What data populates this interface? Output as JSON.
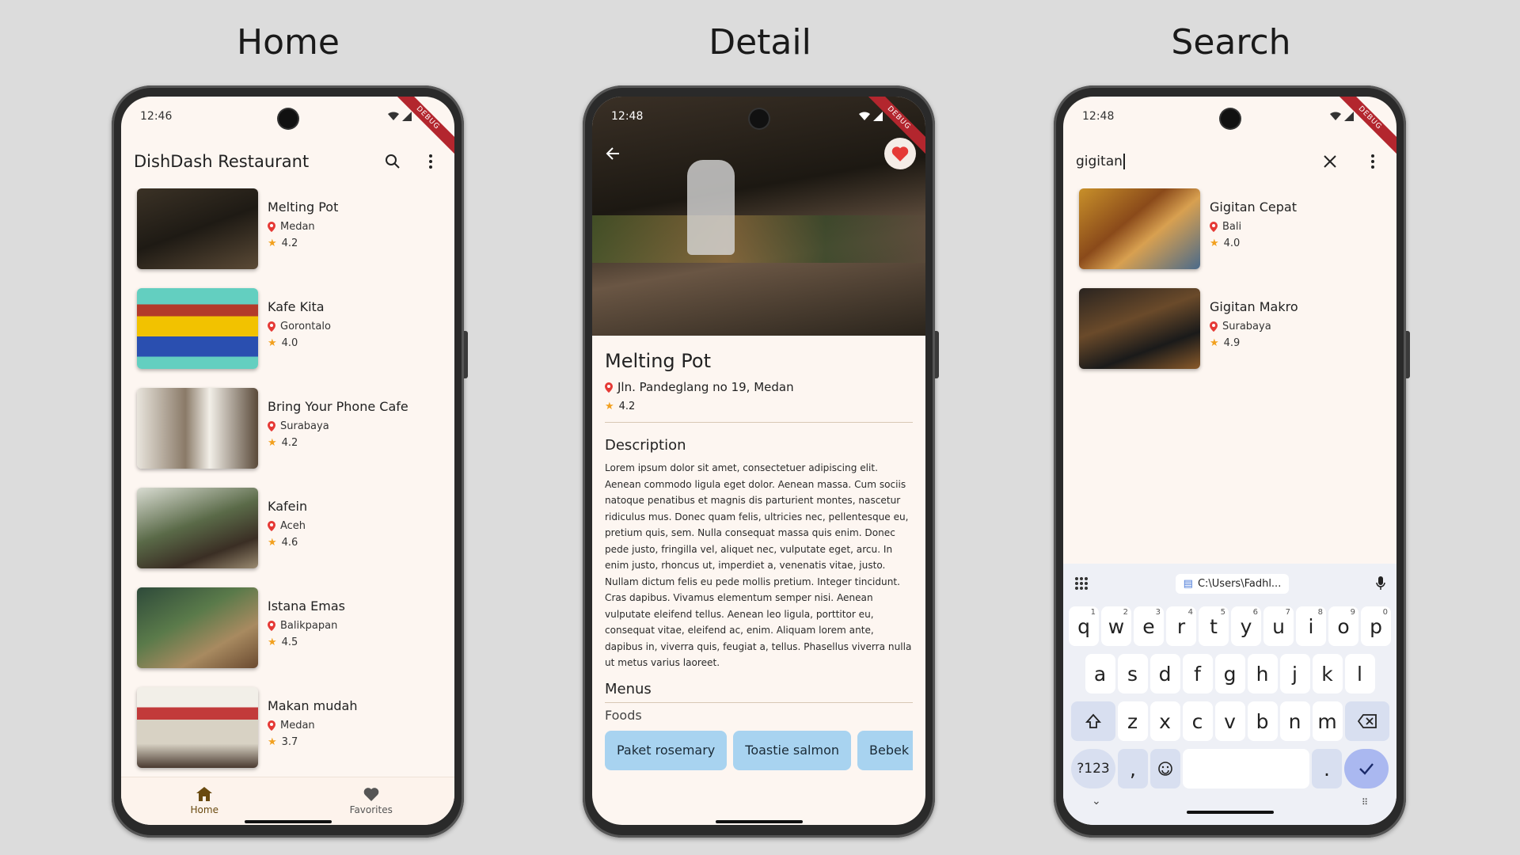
{
  "labels": {
    "home": "Home",
    "detail": "Detail",
    "search": "Search"
  },
  "debug_banner": "DEBUG",
  "home": {
    "time": "12:46",
    "title": "DishDash Restaurant",
    "restaurants": [
      {
        "name": "Melting Pot",
        "city": "Medan",
        "rating": "4.2"
      },
      {
        "name": "Kafe Kita",
        "city": "Gorontalo",
        "rating": "4.0"
      },
      {
        "name": "Bring Your Phone Cafe",
        "city": "Surabaya",
        "rating": "4.2"
      },
      {
        "name": "Kafein",
        "city": "Aceh",
        "rating": "4.6"
      },
      {
        "name": "Istana Emas",
        "city": "Balikpapan",
        "rating": "4.5"
      },
      {
        "name": "Makan mudah",
        "city": "Medan",
        "rating": "3.7"
      }
    ],
    "nav": {
      "home": "Home",
      "favorites": "Favorites"
    }
  },
  "detail": {
    "time": "12:48",
    "name": "Melting Pot",
    "address": "Jln. Pandeglang no 19, Medan",
    "rating": "4.2",
    "description_title": "Description",
    "description": "Lorem ipsum dolor sit amet, consectetuer adipiscing elit. Aenean commodo ligula eget dolor. Aenean massa. Cum sociis natoque penatibus et magnis dis parturient montes, nascetur ridiculus mus. Donec quam felis, ultricies nec, pellentesque eu, pretium quis, sem. Nulla consequat massa quis enim. Donec pede justo, fringilla vel, aliquet nec, vulputate eget, arcu. In enim justo, rhoncus ut, imperdiet a, venenatis vitae, justo. Nullam dictum felis eu pede mollis pretium. Integer tincidunt. Cras dapibus. Vivamus elementum semper nisi. Aenean vulputate eleifend tellus. Aenean leo ligula, porttitor eu, consequat vitae, eleifend ac, enim. Aliquam lorem ante, dapibus in, viverra quis, feugiat a, tellus. Phasellus viverra nulla ut metus varius laoreet.",
    "menus_title": "Menus",
    "foods_title": "Foods",
    "foods": [
      "Paket rosemary",
      "Toastie salmon",
      "Bebek cr"
    ]
  },
  "search": {
    "time": "12:48",
    "query": "gigitan",
    "results": [
      {
        "name": "Gigitan Cepat",
        "city": "Bali",
        "rating": "4.0"
      },
      {
        "name": "Gigitan Makro",
        "city": "Surabaya",
        "rating": "4.9"
      }
    ],
    "clipboard": "C:\\Users\\Fadhl...",
    "keyboard": {
      "row1": [
        "q",
        "w",
        "e",
        "r",
        "t",
        "y",
        "u",
        "i",
        "o",
        "p"
      ],
      "row1_hints": [
        "1",
        "2",
        "3",
        "4",
        "5",
        "6",
        "7",
        "8",
        "9",
        "0"
      ],
      "row2": [
        "a",
        "s",
        "d",
        "f",
        "g",
        "h",
        "j",
        "k",
        "l"
      ],
      "row3": [
        "z",
        "x",
        "c",
        "v",
        "b",
        "n",
        "m"
      ],
      "symbols_key": "?123",
      "comma": ",",
      "period": "."
    }
  }
}
